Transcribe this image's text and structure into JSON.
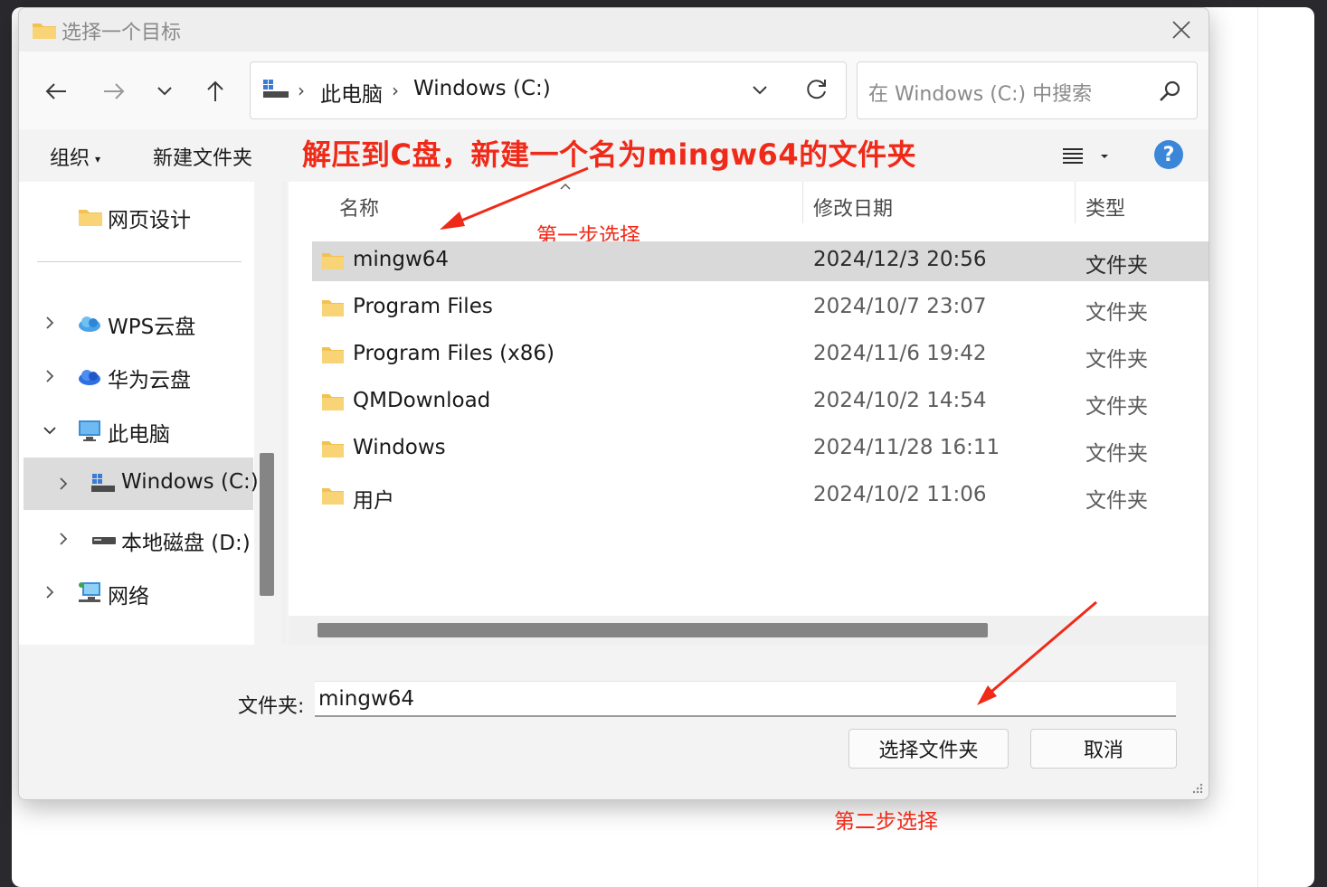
{
  "dialog": {
    "title": "选择一个目标"
  },
  "navigation": {
    "breadcrumb": [
      "此电脑",
      "Windows (C:)"
    ],
    "search_placeholder": "在 Windows (C:) 中搜索"
  },
  "toolbar": {
    "organize_label": "组织",
    "new_folder_label": "新建文件夹"
  },
  "annotations": {
    "headline": "解压到C盘，新建一个名为mingw64的文件夹",
    "step1": "第一步选择",
    "step2": "第二步选择",
    "color": "#f02a18"
  },
  "sidebar": {
    "items": [
      {
        "label": "网页设计",
        "icon": "folder-icon"
      },
      {
        "label": "WPS云盘",
        "icon": "cloud-icon"
      },
      {
        "label": "华为云盘",
        "icon": "cloud-icon"
      },
      {
        "label": "此电脑",
        "icon": "computer-icon"
      },
      {
        "label": "Windows (C:)",
        "icon": "drive-icon",
        "selected": true
      },
      {
        "label": "本地磁盘 (D:)",
        "icon": "drive-icon"
      },
      {
        "label": "网络",
        "icon": "network-icon"
      }
    ]
  },
  "file_list": {
    "columns": [
      "名称",
      "修改日期",
      "类型"
    ],
    "rows": [
      {
        "name": "mingw64",
        "date": "2024/12/3 20:56",
        "type": "文件夹",
        "selected": true
      },
      {
        "name": "Program Files",
        "date": "2024/10/7 23:07",
        "type": "文件夹"
      },
      {
        "name": "Program Files (x86)",
        "date": "2024/11/6 19:42",
        "type": "文件夹"
      },
      {
        "name": "QMDownload",
        "date": "2024/10/2 14:54",
        "type": "文件夹"
      },
      {
        "name": "Windows",
        "date": "2024/11/28 16:11",
        "type": "文件夹"
      },
      {
        "name": "用户",
        "date": "2024/10/2 11:06",
        "type": "文件夹"
      }
    ]
  },
  "footer": {
    "folder_label": "文件夹:",
    "folder_value": "mingw64",
    "select_button": "选择文件夹",
    "cancel_button": "取消"
  }
}
